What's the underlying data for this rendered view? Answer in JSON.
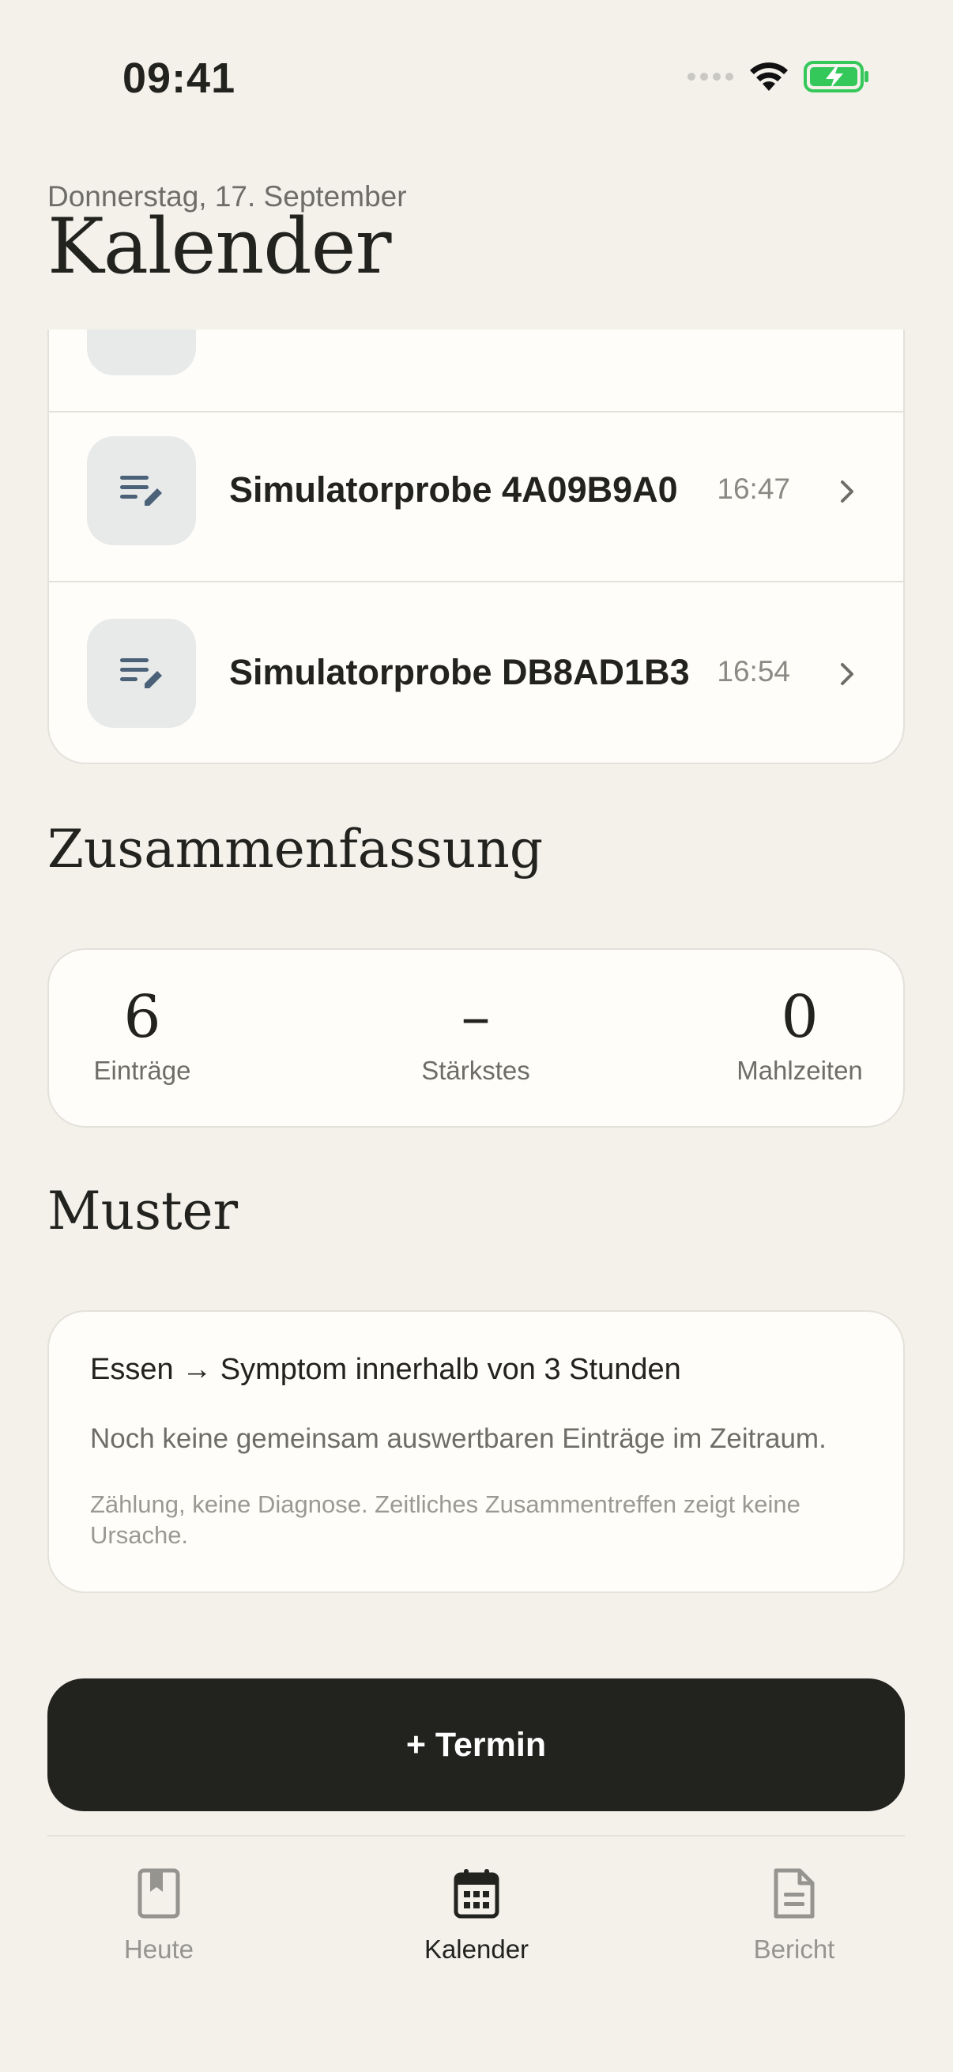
{
  "status_bar": {
    "time": "09:41",
    "icons": [
      "signal-dots-icon",
      "wifi-icon",
      "battery-charging-icon"
    ],
    "battery_color": "#34C759"
  },
  "header": {
    "date": "Donnerstag, 17. September",
    "title": "Kalender"
  },
  "entries": [
    {
      "title": "Simulatorprobe 4A09B9A0",
      "time": "16:47",
      "icon": "note-edit-icon"
    },
    {
      "title": "Simulatorprobe DB8AD1B3",
      "time": "16:54",
      "icon": "note-edit-icon"
    }
  ],
  "summary": {
    "title": "Zusammenfassung",
    "stats": [
      {
        "value": "6",
        "label": "Einträge"
      },
      {
        "value": "–",
        "label": "Stärkstes"
      },
      {
        "value": "0",
        "label": "Mahlzeiten"
      }
    ]
  },
  "patterns": {
    "title": "Muster",
    "heading": "Essen → Symptom innerhalb von 3 Stunden",
    "text": "Noch keine gemeinsam auswertbaren Einträge im Zeitraum.",
    "note": "Zählung, keine Diagnose. Zeitliches Zusammentreffen zeigt keine Ursache."
  },
  "cta": {
    "label": "+ Termin"
  },
  "tabs": [
    {
      "label": "Heute",
      "icon": "bookmark-book-icon",
      "active": false
    },
    {
      "label": "Kalender",
      "icon": "calendar-icon",
      "active": true
    },
    {
      "label": "Bericht",
      "icon": "document-icon",
      "active": false
    }
  ],
  "colors": {
    "background": "#F3F1EA",
    "card": "#FEFDFA",
    "accent_dark": "#22221F",
    "icon_tile": "#E8EAEA",
    "icon_blue": "#4A6178"
  }
}
